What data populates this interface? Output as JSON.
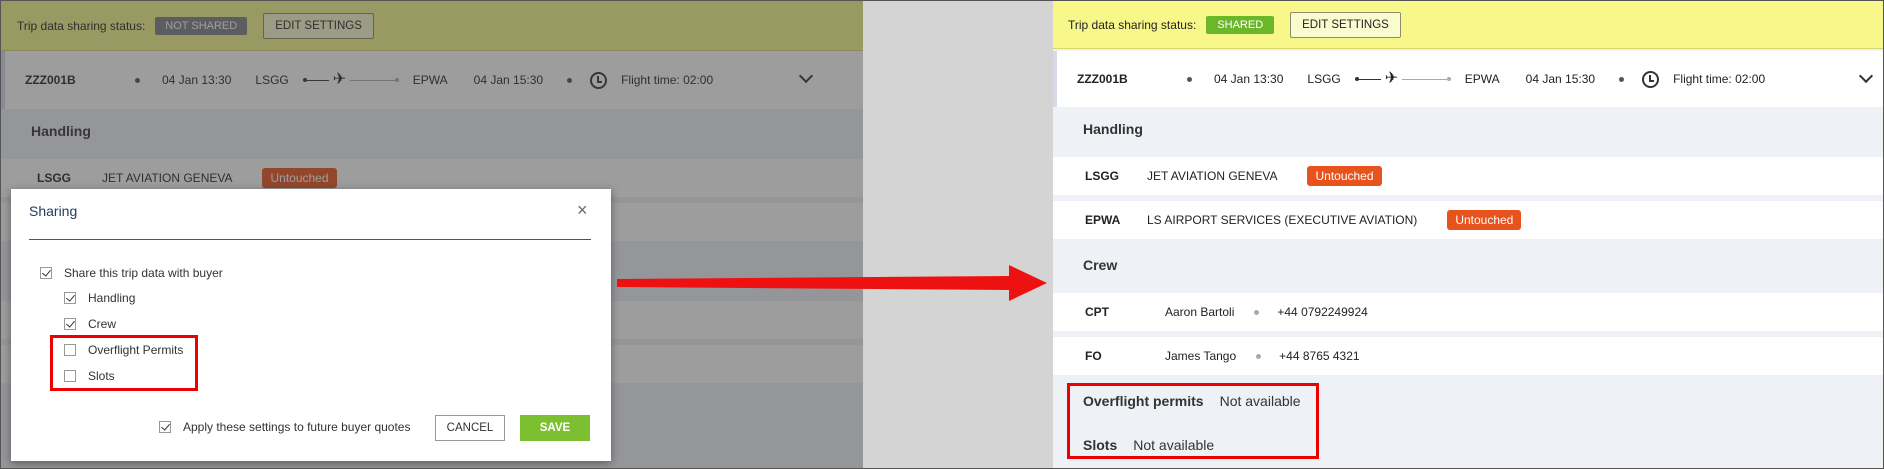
{
  "top_bar": {
    "status_label": "Trip data sharing status:",
    "status_not_shared": "NOT SHARED",
    "status_shared": "SHARED",
    "edit_settings_label": "EDIT SETTINGS"
  },
  "flight": {
    "code": "ZZZ001B",
    "departure_time": "04 Jan 13:30",
    "origin": "LSGG",
    "destination": "EPWA",
    "arrival_time": "04 Jan 15:30",
    "flight_time": "Flight time: 02:00"
  },
  "handling": {
    "title": "Handling",
    "rows": [
      {
        "airport": "LSGG",
        "name": "JET AVIATION GENEVA",
        "status": "Untouched"
      },
      {
        "airport": "EPWA",
        "name": "LS AIRPORT SERVICES (EXECUTIVE AVIATION)",
        "status": "Untouched"
      }
    ]
  },
  "crew": {
    "title": "Crew",
    "rows": [
      {
        "role": "CPT",
        "name": "Aaron Bartoli",
        "phone": "+44 0792249924"
      },
      {
        "role": "FO",
        "name": "James Tango",
        "phone": "+44 8765 4321"
      }
    ]
  },
  "overflight": {
    "label": "Overflight permits",
    "value": "Not available"
  },
  "slots": {
    "label": "Slots",
    "value": "Not available"
  },
  "modal": {
    "title": "Sharing",
    "close_symbol": "×",
    "share_label": "Share this trip data with buyer",
    "options": {
      "handling": "Handling",
      "crew": "Crew",
      "overflight": "Overflight Permits",
      "slots": "Slots"
    },
    "apply_future_label": "Apply these settings to future buyer quotes",
    "cancel_label": "CANCEL",
    "save_label": "SAVE"
  },
  "colors": {
    "not_shared": "#7a7f87",
    "shared": "#6ab82a",
    "untouched": "#e8521c",
    "save": "#7cc032",
    "highlight": "#ee0000",
    "topbar": "#f7f78a"
  },
  "icons": [
    "plane-icon",
    "clock-icon",
    "chevron-down-icon",
    "close-icon",
    "checkbox-icon",
    "arrow-right-icon"
  ]
}
